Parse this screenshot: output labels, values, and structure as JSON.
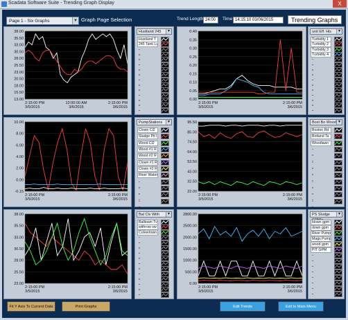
{
  "window": {
    "title": "Scadata Software Suite - Trending Graph Display",
    "close": "X"
  },
  "topbar": {
    "page_select": "Page 1 - Six Graphs",
    "page_label": "Graph Page Selection",
    "trend_length_label": "Trend Length",
    "trend_length": "24:00",
    "time_label": "Time",
    "time_value": "14:15:10  03/06/2015",
    "title": "Trending Graphs"
  },
  "buttons": {
    "fit": "Fit Y Axis To Current Data",
    "print": "Print Graphs",
    "edit": "Edit Trends",
    "exit": "Exit to Main Menu"
  },
  "colors": {
    "background": "#0c2c52",
    "plot_bg": "#000000",
    "edit_button": "#3aa0e0",
    "gold_button": "#c8a864"
  },
  "panels": [
    {
      "header": "Hustland 245",
      "rows": [
        "Hustland T",
        "245 Tank Lv",
        "--",
        "--",
        "--",
        "--",
        "--",
        "--",
        "--",
        "--",
        "--",
        "--",
        "--",
        "--",
        "--"
      ],
      "swatches": [
        "#ffffff",
        "#ff4040",
        "#888888",
        "#888888",
        "#888888",
        "#888888",
        "#888888",
        "#888888",
        "#888888",
        "#888888",
        "#888888",
        "#888888",
        "#888888",
        "#888888",
        "#888888"
      ]
    },
    {
      "header": "unit Eff. His",
      "rows": [
        "Turbidity 1",
        "Turbidity 2",
        "Turbidity 3",
        "Turbidity 4",
        "--",
        "--",
        "--",
        "--",
        "--",
        "--",
        "--",
        "--",
        "--",
        "--",
        "--"
      ],
      "swatches": [
        "#ffffff",
        "#ff4040",
        "#40ff40",
        "#40c0ff",
        "#888888",
        "#888888",
        "#888888",
        "#888888",
        "#888888",
        "#888888",
        "#888888",
        "#888888",
        "#888888",
        "#888888",
        "#888888"
      ]
    },
    {
      "header": "PumpStations",
      "rows": [
        "Clown Cl2",
        "Sludge Pit l",
        "Wood Cl2",
        "Wood #1 R",
        "Wood #2 R",
        "Clown #1 R",
        "Clown #2 R",
        "River Water",
        "--",
        "--",
        "--",
        "--"
      ],
      "swatches": [
        "#ffffff",
        "#ff4040",
        "#40ff40",
        "#40c0ff",
        "#ffa040",
        "#c060ff",
        "#ffff40",
        "#ff80c0",
        "#888888",
        "#888888",
        "#888888",
        "#888888"
      ]
    },
    {
      "header": "Bost Bo Wood",
      "rows": [
        "Boston Rd",
        "Botland Ta",
        "Woodlawn",
        "--",
        "--",
        "--",
        "--",
        "--",
        "--",
        "--",
        "--",
        "--"
      ],
      "swatches": [
        "#ffffff",
        "#ff4040",
        "#40ff40",
        "#888888",
        "#888888",
        "#888888",
        "#888888",
        "#888888",
        "#888888",
        "#888888",
        "#888888",
        "#888888"
      ]
    },
    {
      "header": "Bal Clv With",
      "rows": [
        "Balltown Tv",
        "withrow ow",
        "Culvertown",
        "--",
        "--",
        "--",
        "--",
        "--",
        "--",
        "--",
        "--",
        "--",
        "--",
        "--",
        "--"
      ],
      "swatches": [
        "#ffffff",
        "#ff4040",
        "#40ff40",
        "#888888",
        "#888888",
        "#888888",
        "#888888",
        "#888888",
        "#888888",
        "#888888",
        "#888888",
        "#888888",
        "#888888",
        "#888888",
        "#888888"
      ]
    },
    {
      "header": "PS Sludge GPM's",
      "rows": [
        "blown gpm",
        "down gpm",
        "River Pump",
        "Mags Pump",
        "wood gpm",
        "PIT GPM",
        "--",
        "--",
        "--",
        "--",
        "--",
        "--",
        "--",
        "--"
      ],
      "swatches": [
        "#ffffff",
        "#ff4040",
        "#40ff40",
        "#40c0ff",
        "#ffff40",
        "#c060ff",
        "#888888",
        "#888888",
        "#888888",
        "#888888",
        "#888888",
        "#888888",
        "#888888",
        "#888888"
      ]
    }
  ],
  "chart_data": [
    {
      "type": "line",
      "y_ticks": [
        "38.00",
        "35.50",
        "33.00",
        "30.50",
        "28.00",
        "25.50",
        "23.00",
        "20.50",
        "18.00",
        "15.50",
        "13.00"
      ],
      "ylim": [
        13,
        38
      ],
      "x_ticks": [
        "2:15:00 PM\n3/5/2015",
        "12:00:00 AM\n3/6/2015",
        "2:15:00 PM\n3/6/2015"
      ],
      "series": [
        {
          "color": "#ffffff",
          "values": [
            32,
            34,
            33,
            37,
            35,
            36,
            32,
            31,
            28,
            30,
            22,
            20,
            19,
            21,
            22,
            23,
            28,
            31,
            35,
            37,
            35,
            36,
            37,
            36,
            37,
            35,
            31,
            28,
            33,
            26
          ]
        },
        {
          "color": "#ff4040",
          "values": [
            30,
            31,
            30,
            28,
            27,
            30,
            31,
            31,
            29,
            27,
            25,
            23,
            22,
            22,
            24,
            23,
            24,
            26,
            27,
            27,
            26,
            27,
            28,
            29,
            29,
            28,
            25,
            24,
            24,
            23
          ]
        }
      ]
    },
    {
      "type": "line",
      "y_ticks": [
        "0.40",
        "0.35",
        "0.30",
        "0.25",
        "0.20",
        "0.15",
        "0.10",
        "0.05",
        "0.00"
      ],
      "ylim": [
        0,
        0.4
      ],
      "x_ticks": [
        "2:15:00 PM\n3/5/2015",
        "2:15:00 PM\n3/6/2015"
      ],
      "series": [
        {
          "color": "#ffffff",
          "values": [
            0.03,
            0.03,
            0.04,
            0.05,
            0.06,
            0.06,
            0.08,
            0.12,
            0.14,
            0.11,
            0.09,
            0.08,
            0.08,
            0.08,
            0.07,
            0.07,
            0.07,
            0.07,
            0.06,
            0.06
          ]
        },
        {
          "color": "#40c0ff",
          "values": [
            0.02,
            0.02,
            0.03,
            0.03,
            0.03,
            0.05,
            0.07,
            0.12,
            0.11,
            0.1,
            0.08,
            0.07,
            0.04,
            0.03,
            0.03,
            0.03,
            0.03,
            0.03,
            0.03,
            0.03
          ]
        },
        {
          "color": "#ff4040",
          "values": [
            0.04,
            0.04,
            0.04,
            0.04,
            0.04,
            0.04,
            0.04,
            0.04,
            0.04,
            0.04,
            0.04,
            0.03,
            0.03,
            0.04,
            0.04,
            0.35,
            0.05,
            0.3,
            0.04,
            0.04
          ]
        },
        {
          "color": "#40ff40",
          "values": [
            0.01,
            0.01,
            0.01,
            0.01,
            0.01,
            0.01,
            0.01,
            0.01,
            0.01,
            0.01,
            0.01,
            0.01,
            0.01,
            0.01,
            0.01,
            0.01,
            0.01,
            0.01,
            0.01,
            0.01
          ]
        }
      ]
    },
    {
      "type": "line",
      "y_ticks": [
        "10.00",
        "8.00",
        "6.00",
        "4.00",
        "2.00",
        "0.00",
        "-0.15"
      ],
      "ylim": [
        -0.15,
        10
      ],
      "x_ticks": [
        "2:15:00 PM\n3/5/2015",
        "2:15:00 PM\n3/6/2015"
      ],
      "series": [
        {
          "color": "#ff4040",
          "values": [
            2,
            5,
            8,
            7,
            3,
            0,
            4,
            7,
            9,
            6,
            1,
            0,
            5,
            9,
            7,
            2,
            0,
            6,
            9,
            8,
            2,
            0,
            4
          ]
        },
        {
          "color": "#40c0ff",
          "values": [
            0.8,
            0.8,
            0.9,
            0.8,
            0.8,
            0.8,
            0.8,
            0.9,
            0.8,
            0.8,
            0.8,
            0.8,
            0.8,
            0.8,
            0.8,
            0.8,
            0.9,
            0.8,
            0.8,
            0.8,
            0.8,
            0.8,
            0.8
          ]
        },
        {
          "color": "#ffffff",
          "values": [
            0.2,
            0.3,
            0.2,
            0.2,
            0.4,
            0.2,
            0.2,
            0.3,
            0.2,
            0.2,
            0.3,
            0.2,
            0.2,
            0.2,
            0.3,
            0.2,
            0.2,
            0.3,
            0.2,
            0.2,
            0.2,
            0.3,
            0.2
          ]
        }
      ]
    },
    {
      "type": "line",
      "y_ticks": [
        "95.50",
        "85.00",
        "74.50",
        "64.00",
        "53.50",
        "43.00",
        "32.50",
        "22.00"
      ],
      "ylim": [
        22,
        95.5
      ],
      "x_ticks": [
        "2:15:00 PM\n3/5/2015",
        "2:15:00 PM\n3/6/2015"
      ],
      "series": [
        {
          "color": "#ffffff",
          "values": [
            91,
            91,
            92,
            92,
            92,
            91,
            92,
            92,
            91,
            92,
            92,
            92,
            91,
            92,
            92,
            91,
            92,
            92,
            92,
            92
          ]
        },
        {
          "color": "#ff4040",
          "values": [
            85,
            80,
            82,
            78,
            84,
            80,
            78,
            83,
            85,
            80,
            79,
            84,
            86,
            82,
            79,
            80,
            84,
            82,
            80,
            82
          ]
        },
        {
          "color": "#40ff40",
          "values": [
            32,
            30,
            32,
            29,
            32,
            30,
            28,
            32,
            31,
            29,
            32,
            30,
            28,
            32,
            31,
            29,
            32,
            31,
            29,
            31
          ]
        }
      ]
    },
    {
      "type": "line",
      "y_ticks": [
        "38.00",
        "35.50",
        "33.00",
        "30.50",
        "28.00",
        "25.50",
        "23.00"
      ],
      "ylim": [
        23,
        38
      ],
      "x_ticks": [
        "2:15:00 PM\n3/5/2015",
        "2:15:00 PM\n3/6/2015"
      ],
      "series": [
        {
          "color": "#ff4040",
          "values": [
            36,
            34,
            33,
            32,
            31,
            33,
            32,
            31,
            30,
            29,
            28,
            30,
            29,
            27,
            28,
            27,
            26,
            26,
            27,
            25
          ]
        },
        {
          "color": "#ffffff",
          "values": [
            29,
            31,
            35,
            28,
            32,
            36,
            29,
            31,
            37,
            28,
            30,
            33,
            34,
            31,
            35,
            27,
            32,
            36,
            29,
            30
          ]
        },
        {
          "color": "#40ff40",
          "values": [
            32,
            30,
            27,
            28,
            30,
            33,
            36,
            31,
            28,
            30,
            34,
            37,
            33,
            30,
            27,
            29,
            33,
            36,
            30,
            29
          ]
        }
      ]
    },
    {
      "type": "line",
      "y_ticks": [
        "2800.00",
        "2500.00",
        "2000.00",
        "1500.00",
        "1000.00",
        "500.00",
        "0.00"
      ],
      "ylim": [
        0,
        2800
      ],
      "x_ticks": [
        "2:15:00 PM\n3/5/2015",
        "2:15:00 PM\n3/6/2015"
      ],
      "series": [
        {
          "color": "#40c0ff",
          "values": [
            2000,
            2200,
            1800,
            2300,
            1950,
            2100,
            1900,
            2250,
            1700,
            2000,
            2150,
            1900,
            2200,
            1800,
            2100,
            2000,
            2250,
            1900,
            2000,
            2100
          ]
        },
        {
          "color": "#ffffff",
          "values": [
            300,
            900,
            300,
            300,
            900,
            300,
            900,
            900,
            300,
            300,
            900,
            300,
            300,
            900,
            300,
            900,
            300,
            300,
            900,
            300
          ]
        },
        {
          "color": "#c060ff",
          "values": [
            600,
            700,
            650,
            600,
            700,
            650,
            600,
            700,
            650,
            600,
            700,
            650,
            600,
            700,
            650,
            600,
            700,
            650,
            600,
            700
          ]
        },
        {
          "color": "#ffff40",
          "values": [
            200,
            220,
            200,
            210,
            200,
            220,
            200,
            210,
            200,
            220,
            200,
            210,
            200,
            220,
            200,
            210,
            200,
            220,
            200,
            210
          ]
        },
        {
          "color": "#ff4040",
          "values": [
            100,
            120,
            110,
            100,
            120,
            110,
            100,
            120,
            110,
            100,
            120,
            110,
            100,
            120,
            110,
            100,
            120,
            110,
            100,
            120
          ]
        }
      ]
    }
  ]
}
